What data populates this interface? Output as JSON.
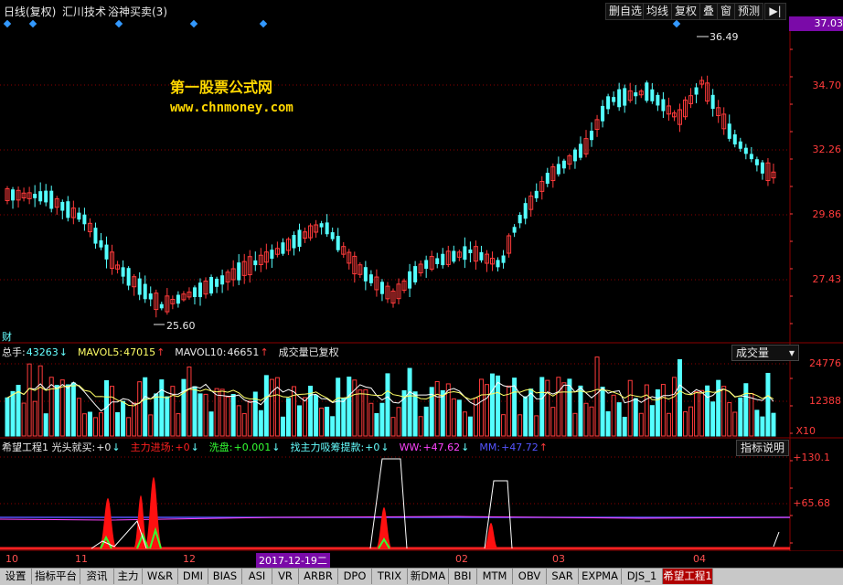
{
  "header": {
    "period_label": "日线(复权)",
    "indicator_name": "汇川技术",
    "formula_name": "浴神买卖(3)",
    "buttons": [
      "删自选",
      "均线",
      "复权",
      "叠",
      "窗",
      "预测"
    ],
    "nav_icon": "play-pause-icon"
  },
  "watermark": {
    "line1": "第一股票公式网",
    "line2": "www.chnmoney.com"
  },
  "price_axis": [
    "37.03",
    "34.70",
    "32.26",
    "29.86",
    "27.43"
  ],
  "price_annotations": {
    "high": "36.49",
    "low": "25.60"
  },
  "cai_label": "财",
  "volume_panel": {
    "legend": [
      {
        "label": "总手:",
        "value": "43263",
        "arrow": "↓",
        "label_color": "#e8e8e8",
        "value_color": "#6ff",
        "arrow_color": "#6ff"
      },
      {
        "label": "MAVOL5:",
        "value": "47015",
        "arrow": "↑",
        "label_color": "#ffff66",
        "value_color": "#ffff66",
        "arrow_color": "#ff3b3b"
      },
      {
        "label": "MAVOL10:",
        "value": "46651",
        "arrow": "↑",
        "label_color": "#e8e8e8",
        "value_color": "#e8e8e8",
        "arrow_color": "#ff3b3b"
      },
      {
        "label": "成交量已复权",
        "value": "",
        "arrow": "",
        "label_color": "#e8e8e8",
        "value_color": "#e8e8e8",
        "arrow_color": "#e8e8e8"
      }
    ],
    "dropdown": "成交量",
    "axis": [
      "24776",
      "12388",
      "X10"
    ]
  },
  "indicator_panel": {
    "legend": [
      {
        "label": "希望工程1 光头就买:",
        "value": "+0",
        "arrow": "↓",
        "label_color": "#e8e8e8",
        "value_color": "#e8e8e8",
        "arrow_color": "#6ff"
      },
      {
        "label": "主力进场:",
        "value": "+0",
        "arrow": "↓",
        "label_color": "#ff2020",
        "value_color": "#ff2020",
        "arrow_color": "#6ff"
      },
      {
        "label": "洗盘:",
        "value": "+0.001",
        "arrow": "↓",
        "label_color": "#33ff33",
        "value_color": "#33ff33",
        "arrow_color": "#6ff"
      },
      {
        "label": "找主力吸筹提款:",
        "value": "+0",
        "arrow": "↓",
        "label_color": "#6ff",
        "value_color": "#6ff",
        "arrow_color": "#6ff"
      },
      {
        "label": "WW:",
        "value": "+47.62",
        "arrow": "↓",
        "label_color": "#ff44ff",
        "value_color": "#ff44ff",
        "arrow_color": "#6ff"
      },
      {
        "label": "MM:",
        "value": "+47.72",
        "arrow": "↑",
        "label_color": "#5555ff",
        "value_color": "#5555ff",
        "arrow_color": "#ff3b3b"
      }
    ],
    "help_button": "指标说明",
    "axis": [
      "+130.1",
      "+65.68"
    ]
  },
  "date_axis": {
    "labels": [
      "10",
      "11",
      "12",
      "2017-12-19二",
      "02",
      "03",
      "04"
    ],
    "selected": "2017-12-19二"
  },
  "tabs": [
    "设置",
    "指标平台",
    "资讯",
    "主力",
    "W&R",
    "DMI",
    "BIAS",
    "ASI",
    "VR",
    "ARBR",
    "DPO",
    "TRIX",
    "新DMA",
    "BBI",
    "MTM",
    "OBV",
    "SAR",
    "EXPMA",
    "DJS_1",
    "希望工程1"
  ],
  "active_tab": "希望工程1",
  "colors": {
    "up": "#ff3b3b",
    "down": "#54ffff",
    "grid": "#8b0000",
    "axis_text": "#ff3b3b",
    "ma5": "#ffffff",
    "ma10": "#ffff66"
  }
}
